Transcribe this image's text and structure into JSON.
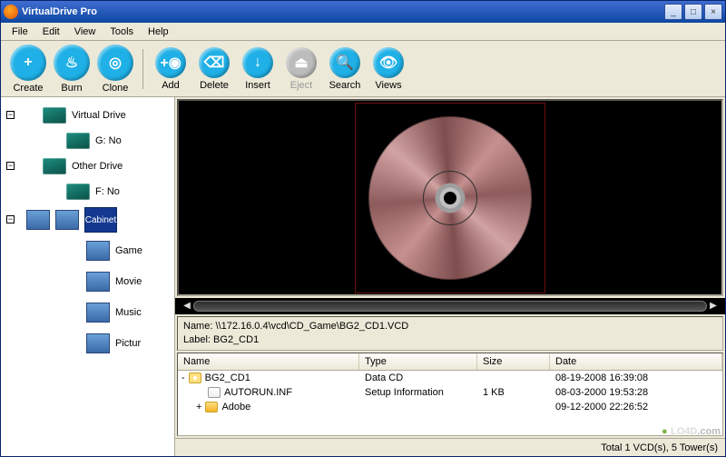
{
  "title": "VirtualDrive Pro",
  "menu": [
    "File",
    "Edit",
    "View",
    "Tools",
    "Help"
  ],
  "toolbar": {
    "create": "Create",
    "burn": "Burn",
    "clone": "Clone",
    "add": "Add",
    "delete": "Delete",
    "insert": "Insert",
    "eject": "Eject",
    "search": "Search",
    "views": "Views"
  },
  "tree": {
    "virtual_drive": "Virtual Drive",
    "g_no": "G: No",
    "other_drive": "Other Drive",
    "f_no": "F: No",
    "cabinet": "Cabinet",
    "game": "Game",
    "movie": "Movie",
    "music": "Music",
    "picture": "Pictur"
  },
  "info": {
    "name_label": "Name:",
    "name_value": "\\\\172.16.0.4\\vcd\\CD_Game\\BG2_CD1.VCD",
    "label_label": "Label:",
    "label_value": "BG2_CD1"
  },
  "filelist": {
    "cols": {
      "name": "Name",
      "type": "Type",
      "size": "Size",
      "date": "Date"
    },
    "rows": [
      {
        "name": "BG2_CD1",
        "type": "Data CD",
        "size": "",
        "date": "08-19-2008 16:39:08",
        "icon": "disc",
        "expander": "-"
      },
      {
        "name": "AUTORUN.INF",
        "type": "Setup Information",
        "size": "1 KB",
        "date": "08-03-2000 19:53:28",
        "icon": "file",
        "expander": ""
      },
      {
        "name": "Adobe",
        "type": "",
        "size": "",
        "date": "09-12-2000 22:26:52",
        "icon": "folder",
        "expander": "+"
      }
    ]
  },
  "status": "Total 1 VCD(s), 5 Tower(s)",
  "watermark": {
    "site": "LO4D",
    "tld": ".com"
  }
}
